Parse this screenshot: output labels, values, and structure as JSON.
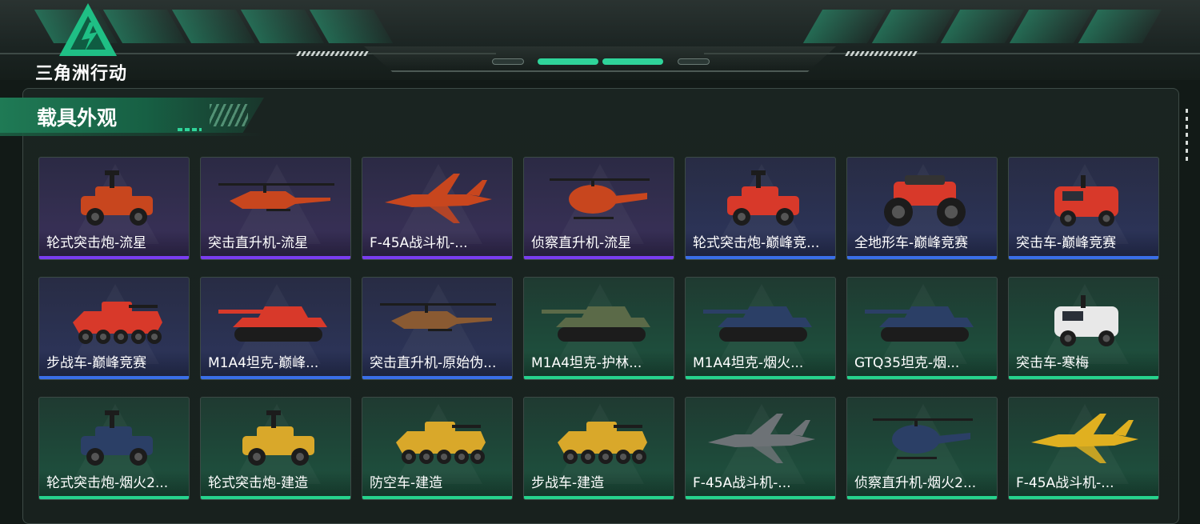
{
  "logo": {
    "text": "三角洲行动"
  },
  "section": {
    "title": "载具外观"
  },
  "colors": {
    "accent": "#2fd49a",
    "purple": "#7a3df0",
    "blue": "#3a6fe8",
    "green": "#26d38d"
  },
  "items": [
    {
      "label": "轮式突击炮-流星",
      "rarity": "purple",
      "icon": "wheeled-assault-gun",
      "tint": "#c8461e"
    },
    {
      "label": "突击直升机-流星",
      "rarity": "purple",
      "icon": "attack-helicopter",
      "tint": "#c8461e"
    },
    {
      "label": "F-45A战斗机-...",
      "rarity": "purple",
      "icon": "fighter-jet",
      "tint": "#c8461e"
    },
    {
      "label": "侦察直升机-流星",
      "rarity": "purple",
      "icon": "scout-helicopter",
      "tint": "#c8461e"
    },
    {
      "label": "轮式突击炮-巅峰竞...",
      "rarity": "blue",
      "icon": "wheeled-assault-gun",
      "tint": "#d8392a"
    },
    {
      "label": "全地形车-巅峰竞赛",
      "rarity": "blue",
      "icon": "atv",
      "tint": "#d8392a"
    },
    {
      "label": "突击车-巅峰竞赛",
      "rarity": "blue",
      "icon": "assault-vehicle",
      "tint": "#d8392a"
    },
    {
      "label": "步战车-巅峰竞赛",
      "rarity": "blue",
      "icon": "ifv",
      "tint": "#d8392a"
    },
    {
      "label": "M1A4坦克-巅峰...",
      "rarity": "blue",
      "icon": "tank",
      "tint": "#d8392a"
    },
    {
      "label": "突击直升机-原始伪...",
      "rarity": "blue",
      "icon": "attack-helicopter",
      "tint": "#8a5a32"
    },
    {
      "label": "M1A4坦克-护林...",
      "rarity": "green",
      "icon": "tank",
      "tint": "#5b6a48"
    },
    {
      "label": "M1A4坦克-烟火...",
      "rarity": "green",
      "icon": "tank",
      "tint": "#2b3f66"
    },
    {
      "label": "GTQ35坦克-烟...",
      "rarity": "green",
      "icon": "tank",
      "tint": "#2b3f66"
    },
    {
      "label": "突击车-寒梅",
      "rarity": "green",
      "icon": "assault-vehicle",
      "tint": "#e8e8e8"
    },
    {
      "label": "轮式突击炮-烟火2...",
      "rarity": "green",
      "icon": "wheeled-assault-gun",
      "tint": "#2b3f66"
    },
    {
      "label": "轮式突击炮-建造",
      "rarity": "green",
      "icon": "wheeled-assault-gun",
      "tint": "#d9a82a"
    },
    {
      "label": "防空车-建造",
      "rarity": "green",
      "icon": "ifv",
      "tint": "#d9a82a"
    },
    {
      "label": "步战车-建造",
      "rarity": "green",
      "icon": "ifv",
      "tint": "#d9a82a"
    },
    {
      "label": "F-45A战斗机-...",
      "rarity": "green",
      "icon": "fighter-jet",
      "tint": "#6d7276"
    },
    {
      "label": "侦察直升机-烟火2...",
      "rarity": "green",
      "icon": "scout-helicopter",
      "tint": "#2b3f66"
    },
    {
      "label": "F-45A战斗机-...",
      "rarity": "green",
      "icon": "fighter-jet",
      "tint": "#e0b020"
    }
  ]
}
